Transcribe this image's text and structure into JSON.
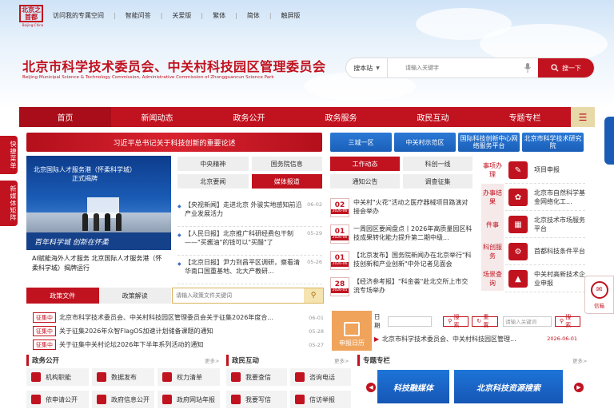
{
  "logo": {
    "text": "北京之首都",
    "sub": "Beijing-China"
  },
  "top_links": [
    "访问我的专属空间",
    "智能问答",
    "关爱版",
    "繁体",
    "简体",
    "触屏版"
  ],
  "title_cn": "北京市科学技术委员会、中关村科技园区管理委员会",
  "title_en": "Beijing Municipal Science & Technology Commission, Administrative Commission of Zhongguancun Science Park",
  "search": {
    "scope": "搜本站",
    "placeholder": "请输入关键字",
    "button": "搜一下"
  },
  "nav": [
    "首页",
    "新闻动态",
    "政务公开",
    "政务服务",
    "政民互动",
    "专题专栏"
  ],
  "side_tabs": [
    "快捷菜单",
    "新媒体矩阵"
  ],
  "banner": "习近平总书记关于科技创新的重要论述",
  "blue_buttons": [
    "三城一区",
    "中关村示范区",
    "国际科技创新中心网络服务平台",
    "北京市科学技术研究院"
  ],
  "photo": {
    "title": "北京国际人才服务港（怀柔科学城）正式揭牌",
    "bottom_text": "百年科学城 创新在怀柔"
  },
  "caption": "AI赋能海外人才服务 北京国际人才服务港（怀柔科学城）揭牌运行",
  "news_tabs": [
    "中央精神",
    "国务院信息",
    "北京要闻",
    "媒体报道"
  ],
  "news": [
    {
      "text": "【央视新闻】走进北京 外骏实地感知前沿产业发展活力",
      "date": "06-02"
    },
    {
      "text": "【人民日报】北京推广科研经费包干制——\"买酱油\"的钱可以\"买醋\"了",
      "date": "05-29"
    },
    {
      "text": "【北京日报】尹力到昌平区调研，察看清华南口国重基地、北大产教研...",
      "date": "05-26"
    }
  ],
  "work_tabs": [
    "工作动态",
    "科创一线",
    "通知公告",
    "调查征集"
  ],
  "work_items": [
    {
      "day": "02",
      "ym": "2026-06",
      "text": "中关村\"火花\"活动之医疗器械项目路演对接会举办"
    },
    {
      "day": "01",
      "ym": "2026-06",
      "text": "一周园区要闻盘点丨2026年高质量园区科技成果转化能力提升第二期中级..."
    },
    {
      "day": "01",
      "ym": "2026-06",
      "text": "【北京发布】国务院新闻办在北京举行\"科技创新和产业创新\"中外记者见面会"
    },
    {
      "day": "28",
      "ym": "2026-05",
      "text": "【经济参考报】\"科金荟\"赴北交所上市交流专场举办"
    }
  ],
  "service_cats": [
    "事项办理",
    "办事结果",
    "件事",
    "科创服务",
    "场景查询"
  ],
  "service_items": [
    "项目申报",
    "北京市自然科学基金网络化工...",
    "北京技术市场服务平台",
    "首都科技条件平台",
    "中关村高新技术企业申报"
  ],
  "policy_tabs": [
    "政策文件",
    "政策解读"
  ],
  "policy_search_placeholder": "请输入政策文件关键词",
  "policy_items": [
    {
      "tag": "征集中",
      "text": "北京市科学技术委员会、中关村科技园区管理委员会关于征集2026年度合...",
      "date": "06-01"
    },
    {
      "tag": "征集中",
      "text": "关于征集2026年众智FlagOS加速计划储备课题的通知",
      "date": "05-28"
    },
    {
      "tag": "征集中",
      "text": "关于征集中关村论坛2026年下半年系列活动的通知",
      "date": "05-27"
    }
  ],
  "calendar": {
    "label": "申报日历",
    "date_label": "日期",
    "search_btn": "搜索",
    "reset_btn": "重置",
    "kw_placeholder": "请输入关键词",
    "search_btn2": "搜索"
  },
  "calendar_item": {
    "text": "北京市科学技术委员会、中关村科技园区管理...",
    "date": "2026-06-01"
  },
  "sections": {
    "gov": {
      "title": "政务公开",
      "more": "更多>"
    },
    "interact": {
      "title": "政民互动",
      "more": "更多>"
    },
    "topic": {
      "title": "专题专栏",
      "more": "更多>"
    }
  },
  "gov_items": [
    "机构职能",
    "数据发布",
    "权力清单",
    "依申请公开",
    "政府信息公开",
    "政府网站年报"
  ],
  "interact_items": [
    "我要查信",
    "咨询电话",
    "我要写信",
    "信访举报"
  ],
  "promos": [
    "科技融媒体",
    "北京科技资源搜索"
  ],
  "float_label": "信箱"
}
